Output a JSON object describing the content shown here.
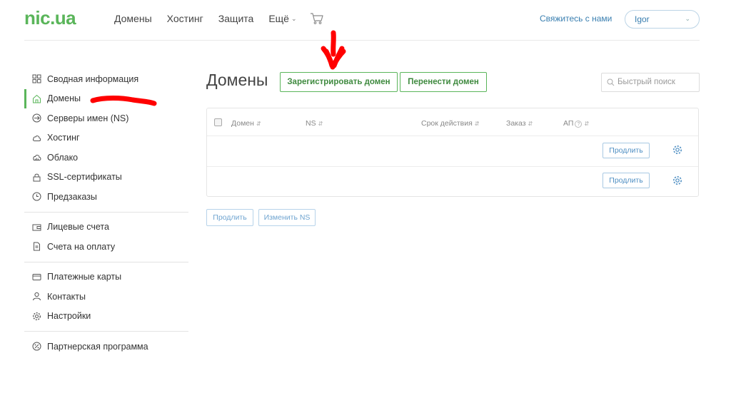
{
  "header": {
    "logo": "nic.ua",
    "nav": [
      {
        "label": "Домены"
      },
      {
        "label": "Хостинг"
      },
      {
        "label": "Защита"
      },
      {
        "label": "Ещё"
      }
    ],
    "contact_link": "Свяжитесь с нами",
    "user": "Igor"
  },
  "sidebar": {
    "items": [
      {
        "label": "Сводная информация",
        "icon": "dashboard-icon"
      },
      {
        "label": "Домены",
        "icon": "home-icon",
        "active": true
      },
      {
        "label": "Серверы имен (NS)",
        "icon": "arrow-circle-icon"
      },
      {
        "label": "Хостинг",
        "icon": "cloud-icon"
      },
      {
        "label": "Облако",
        "icon": "cloud-server-icon"
      },
      {
        "label": "SSL-сертификаты",
        "icon": "lock-icon"
      },
      {
        "label": "Предзаказы",
        "icon": "clock-icon"
      },
      {
        "label": "Лицевые счета",
        "icon": "wallet-icon"
      },
      {
        "label": "Счета на оплату",
        "icon": "invoice-icon"
      },
      {
        "label": "Платежные карты",
        "icon": "card-icon"
      },
      {
        "label": "Контакты",
        "icon": "user-icon"
      },
      {
        "label": "Настройки",
        "icon": "gear-icon"
      },
      {
        "label": "Партнерская программа",
        "icon": "percent-icon"
      }
    ]
  },
  "main": {
    "title": "Домены",
    "register_button": "Зарегистрировать домен",
    "transfer_button": "Перенести домен",
    "search_placeholder": "Быстрый поиск",
    "table": {
      "columns": [
        "Домен",
        "NS",
        "Срок действия",
        "Заказ",
        "АП"
      ],
      "help_symbol": "?",
      "rows": [
        {
          "renew_label": "Продлить"
        },
        {
          "renew_label": "Продлить"
        }
      ]
    },
    "bottom_renew": "Продлить",
    "bottom_change_ns": "Изменить NS"
  },
  "colors": {
    "brand_green": "#5ab55a",
    "link_blue": "#3a7fb0",
    "annotation_red": "#ff0000"
  }
}
